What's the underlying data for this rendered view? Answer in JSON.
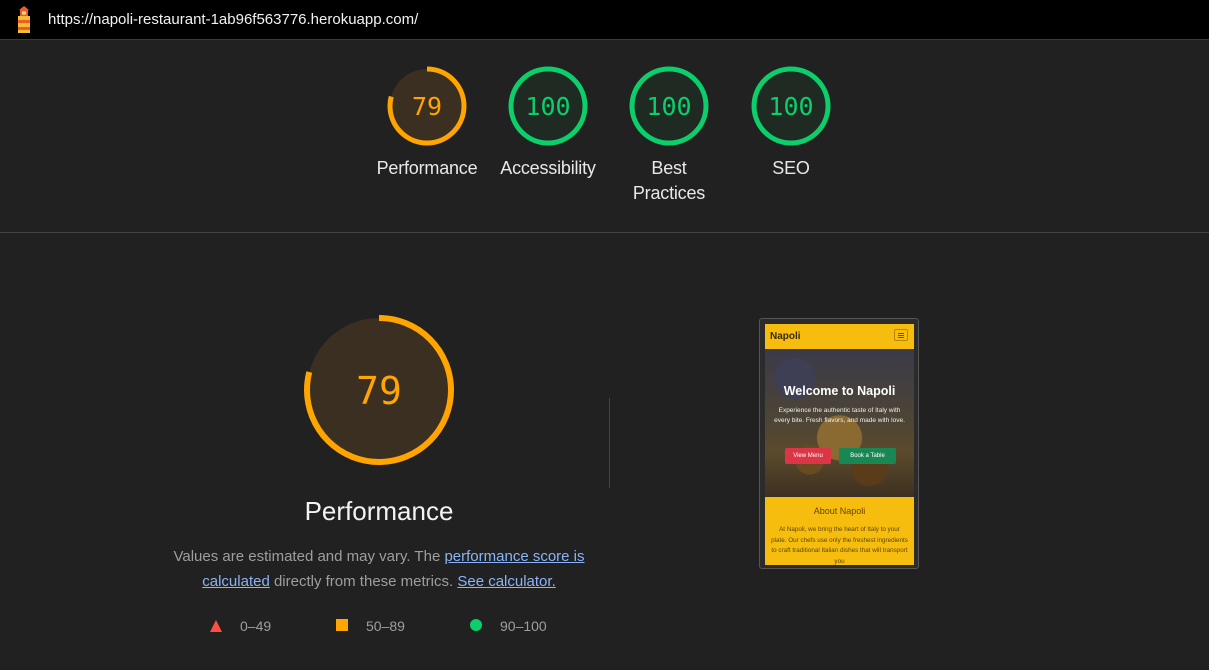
{
  "browser": {
    "url": "https://napoli-restaurant-1ab96f563776.herokuapp.com/",
    "logo_icon": "lighthouse-icon"
  },
  "gauges": [
    {
      "score": "79",
      "label": "Performance",
      "color": "#ffa400",
      "fraction": 0.79
    },
    {
      "score": "100",
      "label": "Accessibility",
      "color": "#0cce6b",
      "fraction": 1.0
    },
    {
      "score": "100",
      "label_line1": "Best",
      "label_line2": "Practices",
      "color": "#0cce6b",
      "fraction": 1.0
    },
    {
      "score": "100",
      "label": "SEO",
      "color": "#0cce6b",
      "fraction": 1.0
    }
  ],
  "performance": {
    "score": "79",
    "fraction": 0.79,
    "title": "Performance",
    "desc_part1": "Values are estimated and may vary. The ",
    "link_score": "performance score is calculated",
    "desc_part2": " directly from these metrics. ",
    "link_calc": "See calculator."
  },
  "legend": [
    {
      "icon": "triangle-icon",
      "range": "0–49",
      "color": "#ff4e42"
    },
    {
      "icon": "square-icon",
      "range": "50–89",
      "color": "#ffa400"
    },
    {
      "icon": "circle-icon",
      "range": "90–100",
      "color": "#0cce6b"
    }
  ],
  "screenshot": {
    "brand": "Napoli",
    "hero_title": "Welcome to Napoli",
    "hero_text": "Experience the authentic taste of Italy with every bite. Fresh flavors, and made with love.",
    "btn_menu": "View Menu",
    "btn_book": "Book a Table",
    "about_title": "About Napoli",
    "about_text": "At Napoli, we bring the heart of Italy to your plate. Our chefs use only the freshest ingredients to craft traditional Italian dishes that will transport you"
  },
  "colors": {
    "background": "#212121",
    "average": "#ffa400",
    "pass": "#0cce6b",
    "fail": "#ff4e42",
    "link": "#8ab4f8"
  }
}
